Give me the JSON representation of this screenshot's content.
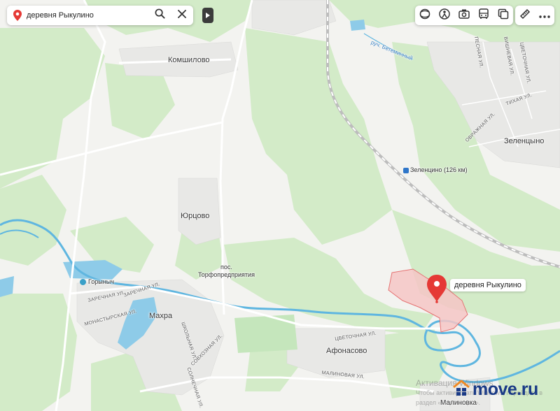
{
  "search": {
    "query": "деревня Рыкулино",
    "pin_icon": "location-pin-icon",
    "search_icon": "search-icon",
    "clear_icon": "close-icon"
  },
  "toolbar": {
    "layers": [
      "layers-icon",
      "panorama-icon",
      "camera-icon",
      "transit-icon",
      "overlay-icon"
    ],
    "tools": [
      "ruler-icon",
      "more-icon"
    ]
  },
  "labels": {
    "komshilovo": "Комшилово",
    "stream": "руч. Бетеминный",
    "pesnaya": "ПЕСНАЯ УЛ.",
    "vishnevaya": "ВИШНЕВАЯ УЛ.",
    "tsvetochnaya_top": "ЦВЕТОЧНАЯ УЛ.",
    "tikhaya": "ТИХАЯ УЛ.",
    "ovrazhnaya": "ОВРАЖНАЯ УЛ.",
    "zelentsyno": "Зеленцыно",
    "station": "Зеленцино (126 км)",
    "yurtsovo": "Юрцово",
    "torf_pos": "пос.",
    "torf_name": "Торфопредприятия",
    "gorynych": "Горыныч",
    "zarechnaya1": "ЗАРЕЧНАЯ УЛ.",
    "zarechnaya2": "ЗАРЕЧНАЯ УЛ.",
    "monastyrskaya": "МОНАСТЫРСКАЯ УЛ.",
    "makhra": "Махра",
    "shkolnaya": "ШКОЛЬНАЯ УЛ.",
    "sovkhoznaya": "СОВХОЗНАЯ УЛ.",
    "solnechnaya": "СОЛНЕЧНАЯ УЛ.",
    "tsvetochnaya": "ЦВЕТОЧНАЯ УЛ.",
    "afonasovo": "Афонасово",
    "malinovaya": "МАЛИНОВАЯ УЛ.",
    "malinovka": "Малиновка"
  },
  "placemark": {
    "label": "деревня Рыкулино",
    "color": "#e53935"
  },
  "watermark": {
    "line1": "Активация Windows",
    "line2": "Чтобы активировать Windows, перейдите в",
    "line3": "раздел «Параметры»."
  },
  "brand": {
    "name": "move.ru"
  },
  "colors": {
    "forest": "#d3ebc8",
    "land": "#f3f3f0",
    "water": "#8ecbe8",
    "river": "#5fb6e0",
    "railway": "#bdbdbd",
    "placemark_area": "#f5c6c6"
  }
}
